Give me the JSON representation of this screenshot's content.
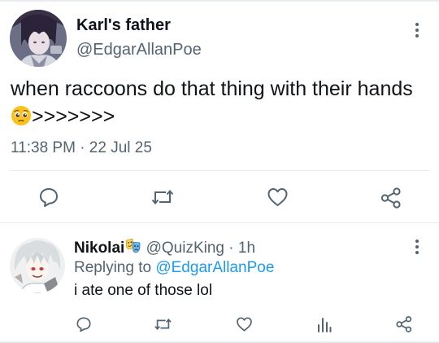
{
  "main_tweet": {
    "display_name": "Karl's father",
    "handle": "@EdgarAllanPoe",
    "text": "when raccoons do that thing with their hands",
    "text_suffix": ">>>>>>>",
    "emoji_icon": "pleading-face-emoji",
    "timestamp": "11:38 PM · 22 Jul 25",
    "actions": [
      "reply-icon",
      "retweet-icon",
      "like-icon",
      "share-icon"
    ]
  },
  "reply": {
    "display_name": "Nikolai",
    "name_emoji_icon": "theater-masks-emoji",
    "handle": "@QuizKing",
    "separator": " · ",
    "age": "1h",
    "replying_prefix": "Replying to ",
    "replying_to": "@EdgarAllanPoe",
    "text": "i ate one of those lol",
    "actions": [
      "reply-icon",
      "retweet-icon",
      "like-icon",
      "analytics-icon",
      "share-icon"
    ]
  },
  "colors": {
    "text_primary": "#0f1419",
    "text_secondary": "#536471",
    "link": "#1d9bf0",
    "divider": "#e6ecf0"
  }
}
